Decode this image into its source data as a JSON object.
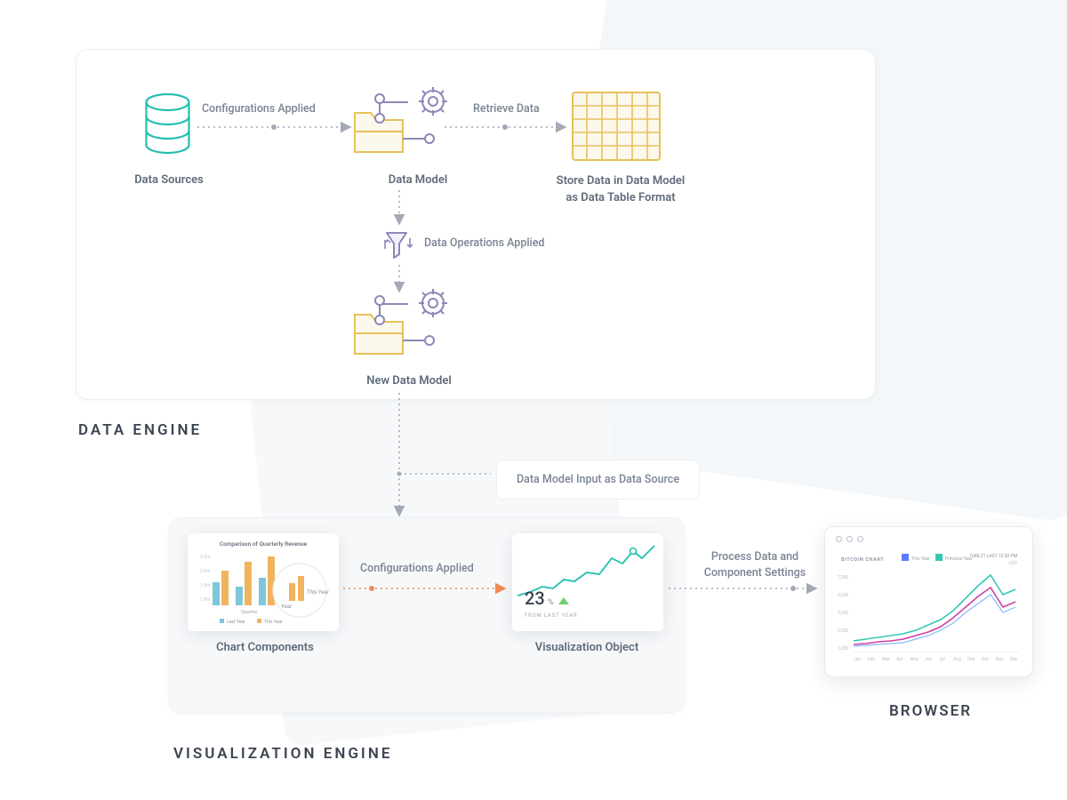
{
  "sections": {
    "data_engine_title": "DATA ENGINE",
    "viz_engine_title": "VISUALIZATION ENGINE",
    "browser_title": "BROWSER"
  },
  "nodes": {
    "data_sources": "Data Sources",
    "data_model": "Data Model",
    "store_data": "Store Data in Data Model as Data Table Format",
    "data_ops": "Data Operations Applied",
    "new_data_model": "New Data Model",
    "chart_components": "Chart Components",
    "viz_object": "Visualization Object",
    "model_input_box": "Data Model Input as Data Source"
  },
  "edges": {
    "config_applied": "Configurations Applied",
    "retrieve_data": "Retrieve Data",
    "config_applied_viz": "Configurations Applied",
    "process_settings": "Process Data and Component Settings"
  },
  "chart_card": {
    "title": "Comparison of Quarterly Revenue",
    "y_ticks": [
      "2.5m",
      "2.0m",
      "1.5m",
      "1.0m"
    ],
    "x_label": "Quarter",
    "legend": [
      "Last Year",
      "This Year"
    ],
    "zoom_labels": [
      "Year",
      "This Year"
    ]
  },
  "viz_card": {
    "value": "23",
    "unit": "%",
    "caption": "FROM LAST YEAR"
  },
  "browser_card": {
    "chart_title": "BITCOIN CHART",
    "legend": [
      "This Year",
      "Previous Year"
    ],
    "stat": "1680.21 LAST 12:30 PM",
    "currency": "USD",
    "y_ticks": [
      "7,000",
      "5,000",
      "3,000",
      "2,000",
      "1,000"
    ],
    "x_ticks": [
      "Jan",
      "Feb",
      "Mar",
      "Apr",
      "May",
      "Jun",
      "Jul",
      "Aug",
      "Sep",
      "Oct",
      "Nov",
      "Dec"
    ]
  },
  "colors": {
    "teal": "#23bfae",
    "amber": "#e8c15a",
    "violet": "#8b88b8",
    "gray": "#a3aab6",
    "orange": "#ef8a54",
    "magenta": "#cf3fa2",
    "skyblue": "#6aa6ff"
  }
}
